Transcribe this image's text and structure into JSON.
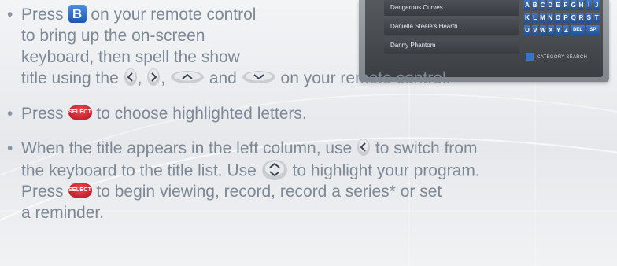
{
  "screenshot": {
    "titles": [
      "Dangerous Curves",
      "Danielle Steele's Hearth...",
      "Danny Phantom"
    ],
    "keyboard_rows": [
      [
        "A",
        "B",
        "C",
        "D",
        "E",
        "F",
        "G",
        "H",
        "I",
        "J"
      ],
      [
        "K",
        "L",
        "M",
        "N",
        "O",
        "P",
        "Q",
        "R",
        "S",
        "T"
      ],
      [
        "U",
        "V",
        "W",
        "X",
        "Y",
        "Z",
        "DEL",
        "SP"
      ]
    ],
    "category_search": "CATEGORY SEARCH"
  },
  "instructions": {
    "item1": {
      "line1_a": "Press",
      "line1_b": "on your remote control",
      "b_key": "B",
      "line2": "to bring up the on-screen",
      "line3": "keyboard, then spell the show",
      "line4_a": "title using the",
      "sep1": ",",
      "sep2": ",",
      "and": "and",
      "line4_b": "on your remote control."
    },
    "item2": {
      "a": "Press",
      "b": "to choose highlighted letters."
    },
    "item3": {
      "line1_a": "When the title appears in the left column, use",
      "line1_b": "to switch from",
      "line2_a": "the keyboard to the title list. Use",
      "line2_b": "to highlight your program.",
      "line3_a": "Press",
      "line3_b": "to begin viewing, record, record a series* or set",
      "line4": "a reminder."
    },
    "select_label": "SELECT",
    "bullet": "•"
  },
  "colors": {
    "text": "#7d8996",
    "b_key": "#2e6bd0",
    "select_button": "#d8232c",
    "arrow_button": "#c9cdd2"
  },
  "icons": {
    "left_arrow": "left-arrow-button-icon",
    "right_arrow": "right-arrow-button-icon",
    "up_arrow": "up-arrow-button-icon",
    "down_arrow": "down-arrow-button-icon",
    "updown": "page-up-down-button-icon",
    "select": "select-button-icon"
  }
}
